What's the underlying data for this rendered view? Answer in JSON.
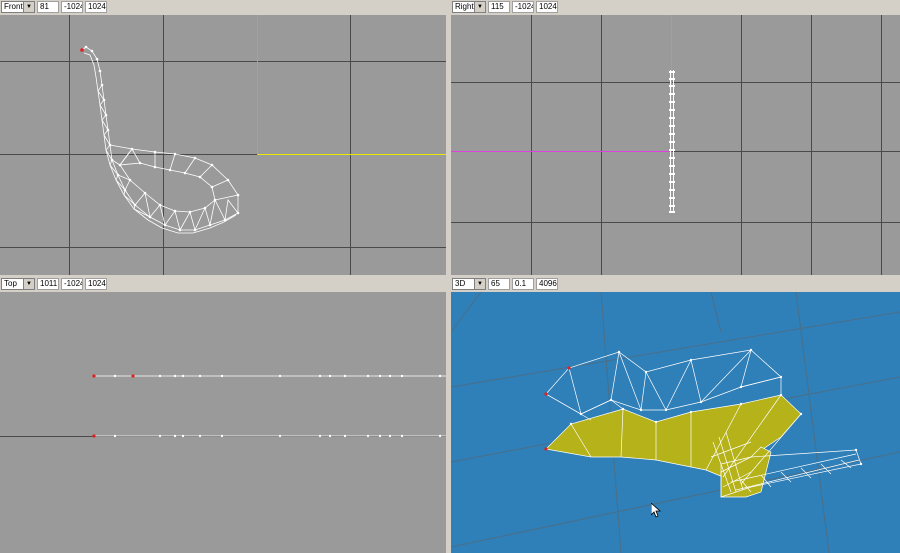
{
  "viewports": [
    {
      "view": "Front",
      "fields": [
        "81",
        "-1024",
        "1024"
      ]
    },
    {
      "view": "Right",
      "fields": [
        "115",
        "-1024",
        "1024"
      ]
    },
    {
      "view": "Top",
      "fields": [
        "1011",
        "-1024",
        "1024"
      ]
    },
    {
      "view": "3D",
      "fields": [
        "65",
        "0.1",
        "4096"
      ]
    }
  ],
  "colors": {
    "ortho_background": "#9a9a9a",
    "grid": "#4a4a4a",
    "perspective_background": "#2f7fb8",
    "wireframe": "#ffffff",
    "axis_cyan": "#00e5e5",
    "axis_yellow": "#e8e800",
    "axis_magenta": "#e040e0",
    "face_fill": "#b5b21a",
    "selected_vertex": "#e02020"
  },
  "icons": [
    "dropdown-arrow-icon",
    "mouse-pointer-icon"
  ]
}
